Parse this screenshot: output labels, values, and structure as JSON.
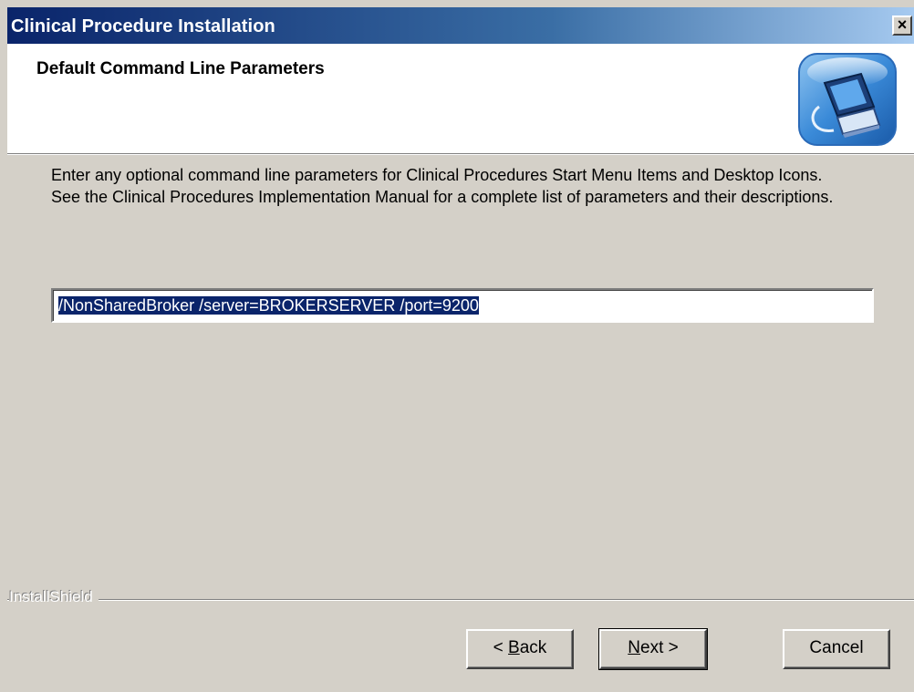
{
  "window": {
    "title": "Clinical Procedure Installation",
    "close_label": "×"
  },
  "header": {
    "title": "Default Command Line Parameters",
    "icon": "computer-setup-icon"
  },
  "body": {
    "instructions": "Enter any optional command line parameters for Clinical Procedures Start Menu Items and Desktop Icons. See the Clinical Procedures Implementation Manual for a complete list of parameters and their descriptions.",
    "parameters_value": "/NonSharedBroker /server=BROKERSERVER /port=9200"
  },
  "footer": {
    "brand": "InstallShield",
    "back_prefix": "< ",
    "back_mnemonic": "B",
    "back_rest": "ack",
    "next_mnemonic": "N",
    "next_rest": "ext >",
    "cancel_label": "Cancel"
  },
  "colors": {
    "title_bar_start": "#0a246a",
    "title_bar_end": "#a6caf0",
    "dialog_face": "#d4d0c8",
    "selection": "#0a246a"
  }
}
